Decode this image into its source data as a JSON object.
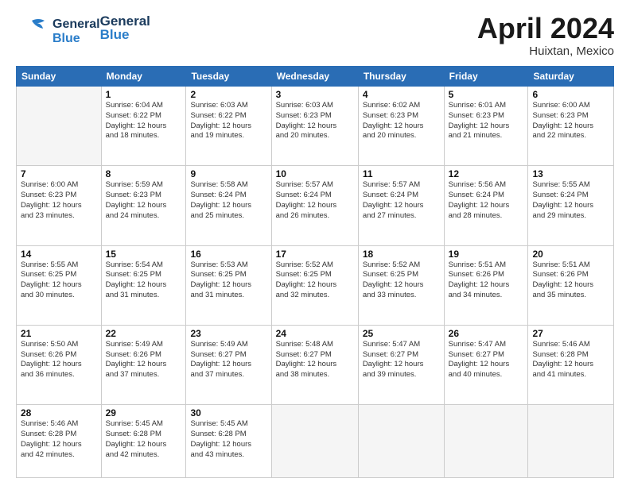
{
  "header": {
    "logo_line1": "General",
    "logo_line2": "Blue",
    "month_year": "April 2024",
    "location": "Huixtan, Mexico"
  },
  "weekdays": [
    "Sunday",
    "Monday",
    "Tuesday",
    "Wednesday",
    "Thursday",
    "Friday",
    "Saturday"
  ],
  "weeks": [
    [
      {
        "num": "",
        "info": ""
      },
      {
        "num": "1",
        "info": "Sunrise: 6:04 AM\nSunset: 6:22 PM\nDaylight: 12 hours\nand 18 minutes."
      },
      {
        "num": "2",
        "info": "Sunrise: 6:03 AM\nSunset: 6:22 PM\nDaylight: 12 hours\nand 19 minutes."
      },
      {
        "num": "3",
        "info": "Sunrise: 6:03 AM\nSunset: 6:23 PM\nDaylight: 12 hours\nand 20 minutes."
      },
      {
        "num": "4",
        "info": "Sunrise: 6:02 AM\nSunset: 6:23 PM\nDaylight: 12 hours\nand 20 minutes."
      },
      {
        "num": "5",
        "info": "Sunrise: 6:01 AM\nSunset: 6:23 PM\nDaylight: 12 hours\nand 21 minutes."
      },
      {
        "num": "6",
        "info": "Sunrise: 6:00 AM\nSunset: 6:23 PM\nDaylight: 12 hours\nand 22 minutes."
      }
    ],
    [
      {
        "num": "7",
        "info": "Sunrise: 6:00 AM\nSunset: 6:23 PM\nDaylight: 12 hours\nand 23 minutes."
      },
      {
        "num": "8",
        "info": "Sunrise: 5:59 AM\nSunset: 6:23 PM\nDaylight: 12 hours\nand 24 minutes."
      },
      {
        "num": "9",
        "info": "Sunrise: 5:58 AM\nSunset: 6:24 PM\nDaylight: 12 hours\nand 25 minutes."
      },
      {
        "num": "10",
        "info": "Sunrise: 5:57 AM\nSunset: 6:24 PM\nDaylight: 12 hours\nand 26 minutes."
      },
      {
        "num": "11",
        "info": "Sunrise: 5:57 AM\nSunset: 6:24 PM\nDaylight: 12 hours\nand 27 minutes."
      },
      {
        "num": "12",
        "info": "Sunrise: 5:56 AM\nSunset: 6:24 PM\nDaylight: 12 hours\nand 28 minutes."
      },
      {
        "num": "13",
        "info": "Sunrise: 5:55 AM\nSunset: 6:24 PM\nDaylight: 12 hours\nand 29 minutes."
      }
    ],
    [
      {
        "num": "14",
        "info": "Sunrise: 5:55 AM\nSunset: 6:25 PM\nDaylight: 12 hours\nand 30 minutes."
      },
      {
        "num": "15",
        "info": "Sunrise: 5:54 AM\nSunset: 6:25 PM\nDaylight: 12 hours\nand 31 minutes."
      },
      {
        "num": "16",
        "info": "Sunrise: 5:53 AM\nSunset: 6:25 PM\nDaylight: 12 hours\nand 31 minutes."
      },
      {
        "num": "17",
        "info": "Sunrise: 5:52 AM\nSunset: 6:25 PM\nDaylight: 12 hours\nand 32 minutes."
      },
      {
        "num": "18",
        "info": "Sunrise: 5:52 AM\nSunset: 6:25 PM\nDaylight: 12 hours\nand 33 minutes."
      },
      {
        "num": "19",
        "info": "Sunrise: 5:51 AM\nSunset: 6:26 PM\nDaylight: 12 hours\nand 34 minutes."
      },
      {
        "num": "20",
        "info": "Sunrise: 5:51 AM\nSunset: 6:26 PM\nDaylight: 12 hours\nand 35 minutes."
      }
    ],
    [
      {
        "num": "21",
        "info": "Sunrise: 5:50 AM\nSunset: 6:26 PM\nDaylight: 12 hours\nand 36 minutes."
      },
      {
        "num": "22",
        "info": "Sunrise: 5:49 AM\nSunset: 6:26 PM\nDaylight: 12 hours\nand 37 minutes."
      },
      {
        "num": "23",
        "info": "Sunrise: 5:49 AM\nSunset: 6:27 PM\nDaylight: 12 hours\nand 37 minutes."
      },
      {
        "num": "24",
        "info": "Sunrise: 5:48 AM\nSunset: 6:27 PM\nDaylight: 12 hours\nand 38 minutes."
      },
      {
        "num": "25",
        "info": "Sunrise: 5:47 AM\nSunset: 6:27 PM\nDaylight: 12 hours\nand 39 minutes."
      },
      {
        "num": "26",
        "info": "Sunrise: 5:47 AM\nSunset: 6:27 PM\nDaylight: 12 hours\nand 40 minutes."
      },
      {
        "num": "27",
        "info": "Sunrise: 5:46 AM\nSunset: 6:28 PM\nDaylight: 12 hours\nand 41 minutes."
      }
    ],
    [
      {
        "num": "28",
        "info": "Sunrise: 5:46 AM\nSunset: 6:28 PM\nDaylight: 12 hours\nand 42 minutes."
      },
      {
        "num": "29",
        "info": "Sunrise: 5:45 AM\nSunset: 6:28 PM\nDaylight: 12 hours\nand 42 minutes."
      },
      {
        "num": "30",
        "info": "Sunrise: 5:45 AM\nSunset: 6:28 PM\nDaylight: 12 hours\nand 43 minutes."
      },
      {
        "num": "",
        "info": ""
      },
      {
        "num": "",
        "info": ""
      },
      {
        "num": "",
        "info": ""
      },
      {
        "num": "",
        "info": ""
      }
    ]
  ]
}
